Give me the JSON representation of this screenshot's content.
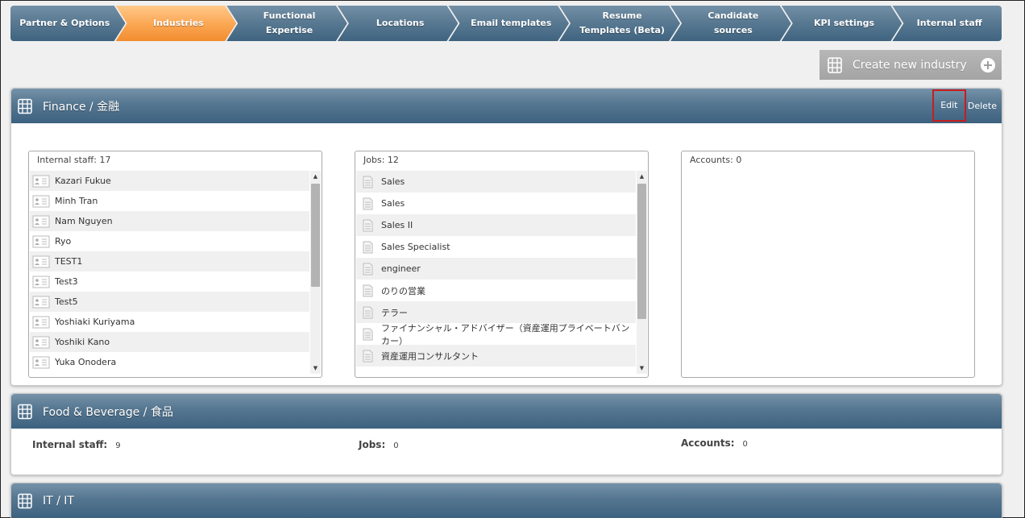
{
  "wizard": {
    "steps": [
      {
        "label": "Partner & Options",
        "active": false
      },
      {
        "label": "Industries",
        "active": true
      },
      {
        "label": "Functional Expertise",
        "active": false
      },
      {
        "label": "Locations",
        "active": false
      },
      {
        "label": "Email templates",
        "active": false
      },
      {
        "label": "Resume Templates (Beta)",
        "active": false
      },
      {
        "label": "Candidate sources",
        "active": false
      },
      {
        "label": "KPI settings",
        "active": false
      },
      {
        "label": "Internal staff",
        "active": false
      }
    ]
  },
  "create_button": {
    "label": "Create new industry",
    "icon": "building-icon",
    "action_icon": "plus-circle-icon"
  },
  "industries": [
    {
      "title": "Finance / 金融",
      "edit_label": "Edit",
      "delete_label": "Delete",
      "internal_staff": {
        "header": "Internal staff: 17",
        "items": [
          "Kazari Fukue",
          "Minh Tran",
          "Nam Nguyen",
          "Ryo",
          "TEST1",
          "Test3",
          "Test5",
          "Yoshiaki Kuriyama",
          "Yoshiki Kano",
          "Yuka Onodera"
        ]
      },
      "jobs": {
        "header": "Jobs: 12",
        "items": [
          "Sales",
          "Sales",
          "Sales II",
          "Sales Specialist",
          "engineer",
          "のりの営業",
          "テラー",
          "ファイナンシャル・アドバイザー（資産運用プライベートバンカー）",
          "資産運用コンサルタント"
        ]
      },
      "accounts": {
        "header": "Accounts: 0"
      }
    },
    {
      "title": "Food & Beverage / 食品",
      "stats": {
        "staff_label": "Internal staff:",
        "staff_value": "9",
        "jobs_label": "Jobs:",
        "jobs_value": "0",
        "accounts_label": "Accounts:",
        "accounts_value": "0"
      }
    },
    {
      "title": "IT / IT"
    }
  ],
  "colors": {
    "header_blue": "#557690",
    "active_orange": "#f79a3e",
    "edit_highlight": "#c61e1e"
  }
}
